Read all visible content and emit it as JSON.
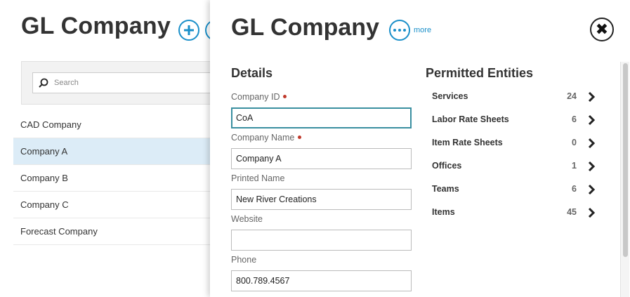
{
  "background": {
    "title": "GL Company",
    "search_placeholder": "Search",
    "list": [
      {
        "label": "CAD Company",
        "selected": false
      },
      {
        "label": "Company A",
        "selected": true
      },
      {
        "label": "Company B",
        "selected": false
      },
      {
        "label": "Company C",
        "selected": false
      },
      {
        "label": "Forecast Company",
        "selected": false
      }
    ]
  },
  "panel": {
    "title": "GL Company",
    "more_label": "more",
    "details_heading": "Details",
    "fields": {
      "company_id": {
        "label": "Company ID",
        "value": "CoA",
        "required": true
      },
      "company_name": {
        "label": "Company Name",
        "value": "Company A",
        "required": true
      },
      "printed_name": {
        "label": "Printed Name",
        "value": "New River Creations"
      },
      "website": {
        "label": "Website",
        "value": ""
      },
      "phone": {
        "label": "Phone",
        "value": "800.789.4567"
      }
    },
    "permitted_heading": "Permitted Entities",
    "entities": [
      {
        "label": "Services",
        "count": "24"
      },
      {
        "label": "Labor Rate Sheets",
        "count": "6"
      },
      {
        "label": "Item Rate Sheets",
        "count": "0"
      },
      {
        "label": "Offices",
        "count": "1"
      },
      {
        "label": "Teams",
        "count": "6"
      },
      {
        "label": "Items",
        "count": "45"
      }
    ]
  },
  "colors": {
    "accent": "#1a8fc9",
    "selected_row": "#dcecf7",
    "required_dot": "#c0392b",
    "focus_border": "#3a8fa0"
  }
}
